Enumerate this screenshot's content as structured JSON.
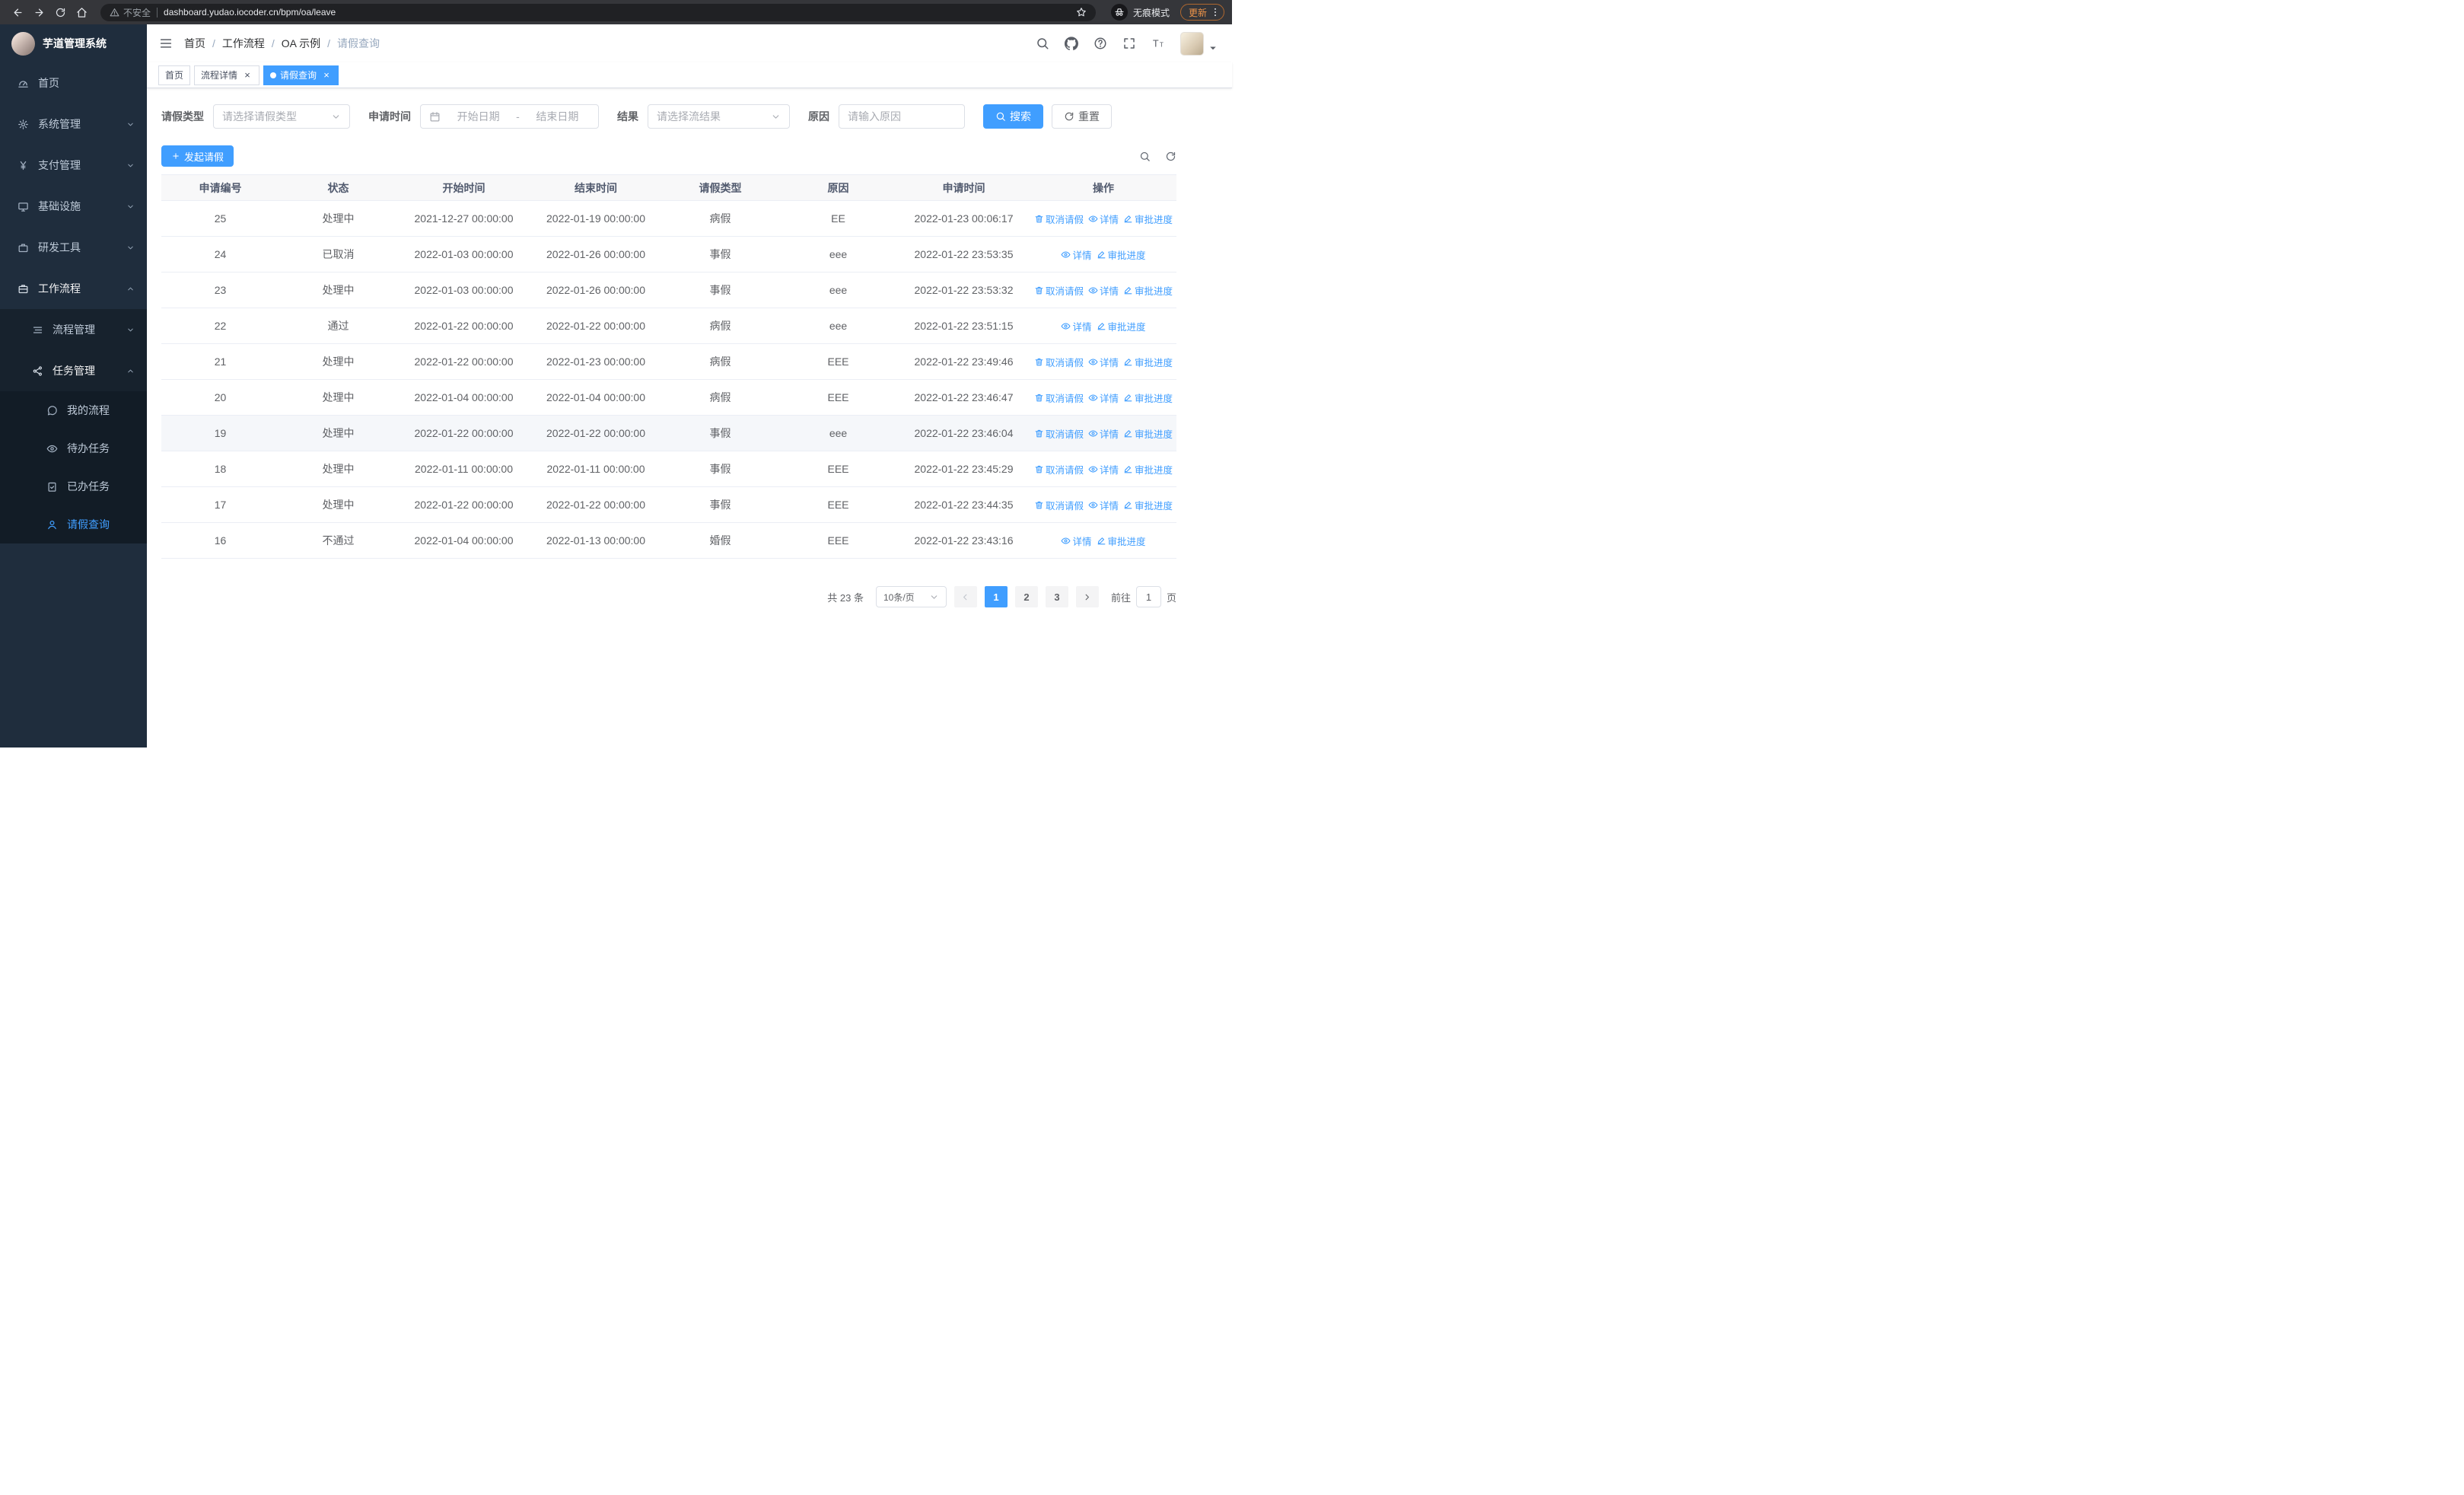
{
  "theme": {
    "accent_color": "#409eff",
    "sidebar_color": "#1f2d3d"
  },
  "browser": {
    "url": "dashboard.yudao.iocoder.cn/bpm/oa/leave",
    "security_label": "不安全",
    "incognito_label": "无痕模式",
    "update_label": "更新"
  },
  "app": {
    "logo_title": "芋道管理系统",
    "breadcrumb": [
      "首页",
      "工作流程",
      "OA 示例",
      "请假查询"
    ],
    "tabs": [
      {
        "label": "首页",
        "closable": false,
        "active": false
      },
      {
        "label": "流程详情",
        "closable": true,
        "active": false
      },
      {
        "label": "请假查询",
        "closable": true,
        "active": true
      }
    ]
  },
  "sidebar_menu": [
    {
      "label": "首页",
      "icon": "gauge",
      "level": 1
    },
    {
      "label": "系统管理",
      "icon": "gear",
      "level": 1,
      "caret": "down"
    },
    {
      "label": "支付管理",
      "icon": "yen",
      "level": 1,
      "caret": "down"
    },
    {
      "label": "基础设施",
      "icon": "monitor",
      "level": 1,
      "caret": "down"
    },
    {
      "label": "研发工具",
      "icon": "briefcase",
      "level": 1,
      "caret": "down"
    },
    {
      "label": "工作流程",
      "icon": "suitcase",
      "level": 1,
      "caret": "up",
      "open": true
    },
    {
      "label": "流程管理",
      "icon": "list-tree",
      "level": 2,
      "caret": "down"
    },
    {
      "label": "任务管理",
      "icon": "share",
      "level": 2,
      "caret": "up",
      "open": true
    },
    {
      "label": "我的流程",
      "icon": "chat",
      "level": 3
    },
    {
      "label": "待办任务",
      "icon": "eye",
      "level": 3
    },
    {
      "label": "已办任务",
      "icon": "clipboard-check",
      "level": 3
    },
    {
      "label": "请假查询",
      "icon": "user",
      "level": 3,
      "active": true
    }
  ],
  "filters": {
    "leave_type_label": "请假类型",
    "leave_type_placeholder": "请选择请假类型",
    "apply_time_label": "申请时间",
    "start_placeholder": "开始日期",
    "range_separator": "-",
    "end_placeholder": "结束日期",
    "result_label": "结果",
    "result_placeholder": "请选择流结果",
    "reason_label": "原因",
    "reason_placeholder": "请输入原因",
    "search_label": "搜索",
    "reset_label": "重置"
  },
  "toolbar": {
    "create_label": "发起请假"
  },
  "table": {
    "columns": [
      "申请编号",
      "状态",
      "开始时间",
      "结束时间",
      "请假类型",
      "原因",
      "申请时间",
      "操作"
    ],
    "action_labels": {
      "cancel": "取消请假",
      "detail": "详情",
      "progress": "审批进度"
    },
    "rows": [
      {
        "id": "25",
        "status": "处理中",
        "start": "2021-12-27 00:00:00",
        "end": "2022-01-19 00:00:00",
        "type": "病假",
        "reason": "EE",
        "applied": "2022-01-23 00:06:17",
        "cancellable": true,
        "highlight": false
      },
      {
        "id": "24",
        "status": "已取消",
        "start": "2022-01-03 00:00:00",
        "end": "2022-01-26 00:00:00",
        "type": "事假",
        "reason": "eee",
        "applied": "2022-01-22 23:53:35",
        "cancellable": false,
        "highlight": false
      },
      {
        "id": "23",
        "status": "处理中",
        "start": "2022-01-03 00:00:00",
        "end": "2022-01-26 00:00:00",
        "type": "事假",
        "reason": "eee",
        "applied": "2022-01-22 23:53:32",
        "cancellable": true,
        "highlight": false
      },
      {
        "id": "22",
        "status": "通过",
        "start": "2022-01-22 00:00:00",
        "end": "2022-01-22 00:00:00",
        "type": "病假",
        "reason": "eee",
        "applied": "2022-01-22 23:51:15",
        "cancellable": false,
        "highlight": false
      },
      {
        "id": "21",
        "status": "处理中",
        "start": "2022-01-22 00:00:00",
        "end": "2022-01-23 00:00:00",
        "type": "病假",
        "reason": "EEE",
        "applied": "2022-01-22 23:49:46",
        "cancellable": true,
        "highlight": false
      },
      {
        "id": "20",
        "status": "处理中",
        "start": "2022-01-04 00:00:00",
        "end": "2022-01-04 00:00:00",
        "type": "病假",
        "reason": "EEE",
        "applied": "2022-01-22 23:46:47",
        "cancellable": true,
        "highlight": false
      },
      {
        "id": "19",
        "status": "处理中",
        "start": "2022-01-22 00:00:00",
        "end": "2022-01-22 00:00:00",
        "type": "事假",
        "reason": "eee",
        "applied": "2022-01-22 23:46:04",
        "cancellable": true,
        "highlight": true
      },
      {
        "id": "18",
        "status": "处理中",
        "start": "2022-01-11 00:00:00",
        "end": "2022-01-11 00:00:00",
        "type": "事假",
        "reason": "EEE",
        "applied": "2022-01-22 23:45:29",
        "cancellable": true,
        "highlight": false
      },
      {
        "id": "17",
        "status": "处理中",
        "start": "2022-01-22 00:00:00",
        "end": "2022-01-22 00:00:00",
        "type": "事假",
        "reason": "EEE",
        "applied": "2022-01-22 23:44:35",
        "cancellable": true,
        "highlight": false
      },
      {
        "id": "16",
        "status": "不通过",
        "start": "2022-01-04 00:00:00",
        "end": "2022-01-13 00:00:00",
        "type": "婚假",
        "reason": "EEE",
        "applied": "2022-01-22 23:43:16",
        "cancellable": false,
        "highlight": false
      }
    ]
  },
  "pagination": {
    "total": "共 23 条",
    "page_size": "10条/页",
    "pages": [
      "1",
      "2",
      "3"
    ],
    "current": "1",
    "goto_label": "前往",
    "goto_value": "1",
    "goto_suffix": "页"
  }
}
